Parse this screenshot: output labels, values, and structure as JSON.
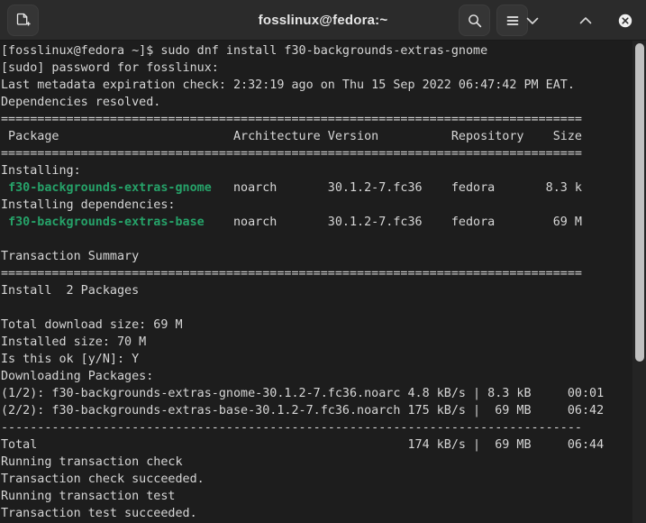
{
  "window": {
    "title": "fosslinux@fedora:~",
    "background_color": "#1d1d1d",
    "titlebar_color": "#2b2b2b"
  },
  "titlebar": {
    "new_tab_label": "New Tab",
    "search_label": "Search",
    "menu_label": "Main Menu",
    "minimize_label": "Minimize",
    "maximize_label": "Maximize",
    "close_label": "Close"
  },
  "terminal": {
    "prompt": "[fosslinux@fedora ~]$",
    "command": "sudo dnf install f30-backgrounds-extras-gnome",
    "package_color": "#26a269",
    "text_color": "#d6d6d6",
    "columns": {
      "package": "Package",
      "architecture": "Architecture",
      "version": "Version",
      "repository": "Repository",
      "size": "Size"
    },
    "packages": [
      {
        "group": "Installing:",
        "name": "f30-backgrounds-extras-gnome",
        "arch": "noarch",
        "version": "30.1.2-7.fc36",
        "repo": "fedora",
        "size": "8.3 k"
      },
      {
        "group": "Installing dependencies:",
        "name": "f30-backgrounds-extras-base",
        "arch": "noarch",
        "version": "30.1.2-7.fc36",
        "repo": "fedora",
        "size": "69 M"
      }
    ],
    "summary": {
      "heading": "Transaction Summary",
      "install_line": "Install  2 Packages",
      "total_download_size": "Total download size: 69 M",
      "installed_size": "Installed size: 70 M",
      "confirm_prompt": "Is this ok [y/N]:",
      "confirm_answer": "Y"
    },
    "downloads": [
      {
        "index": "(1/2):",
        "file": "f30-backgrounds-extras-gnome-30.1.2-7.fc36.noarc",
        "rate": "4.8 kB/s",
        "size": "8.3 kB",
        "time": "00:01"
      },
      {
        "index": "(2/2):",
        "file": "f30-backgrounds-extras-base-30.1.2-7.fc36.noarch",
        "rate": "175 kB/s",
        "size": "69 MB",
        "time": "06:42"
      }
    ],
    "total_row": {
      "label": "Total",
      "rate": "174 kB/s",
      "size": "69 MB",
      "time": "06:44"
    },
    "lines": [
      {
        "type": "prompt",
        "text": "[fosslinux@fedora ~]$ sudo dnf install f30-backgrounds-extras-gnome"
      },
      {
        "type": "plain",
        "text": "[sudo] password for fosslinux:"
      },
      {
        "type": "plain",
        "text": "Last metadata expiration check: 2:32:19 ago on Thu 15 Sep 2022 06:47:42 PM EAT."
      },
      {
        "type": "plain",
        "text": "Dependencies resolved."
      },
      {
        "type": "plain",
        "text": "================================================================================"
      },
      {
        "type": "plain",
        "text": " Package                        Architecture Version          Repository    Size"
      },
      {
        "type": "plain",
        "text": "================================================================================"
      },
      {
        "type": "plain",
        "text": "Installing:"
      },
      {
        "type": "pkg",
        "pre": " ",
        "pkg": "f30-backgrounds-extras-gnome",
        "post": "   noarch       30.1.2-7.fc36    fedora       8.3 k"
      },
      {
        "type": "plain",
        "text": "Installing dependencies:"
      },
      {
        "type": "pkg",
        "pre": " ",
        "pkg": "f30-backgrounds-extras-base",
        "post": "    noarch       30.1.2-7.fc36    fedora        69 M"
      },
      {
        "type": "plain",
        "text": ""
      },
      {
        "type": "plain",
        "text": "Transaction Summary"
      },
      {
        "type": "plain",
        "text": "================================================================================"
      },
      {
        "type": "plain",
        "text": "Install  2 Packages"
      },
      {
        "type": "plain",
        "text": ""
      },
      {
        "type": "plain",
        "text": "Total download size: 69 M"
      },
      {
        "type": "plain",
        "text": "Installed size: 70 M"
      },
      {
        "type": "plain",
        "text": "Is this ok [y/N]: Y"
      },
      {
        "type": "plain",
        "text": "Downloading Packages:"
      },
      {
        "type": "plain",
        "text": "(1/2): f30-backgrounds-extras-gnome-30.1.2-7.fc36.noarc 4.8 kB/s | 8.3 kB     00:01"
      },
      {
        "type": "plain",
        "text": "(2/2): f30-backgrounds-extras-base-30.1.2-7.fc36.noarch 175 kB/s |  69 MB     06:42"
      },
      {
        "type": "plain",
        "text": "--------------------------------------------------------------------------------"
      },
      {
        "type": "plain",
        "text": "Total                                                   174 kB/s |  69 MB     06:44"
      },
      {
        "type": "plain",
        "text": "Running transaction check"
      },
      {
        "type": "plain",
        "text": "Transaction check succeeded."
      },
      {
        "type": "plain",
        "text": "Running transaction test"
      },
      {
        "type": "plain",
        "text": "Transaction test succeeded."
      }
    ]
  },
  "scrollbar": {
    "thumb_top_pct": 0,
    "thumb_height_pct": 66
  }
}
